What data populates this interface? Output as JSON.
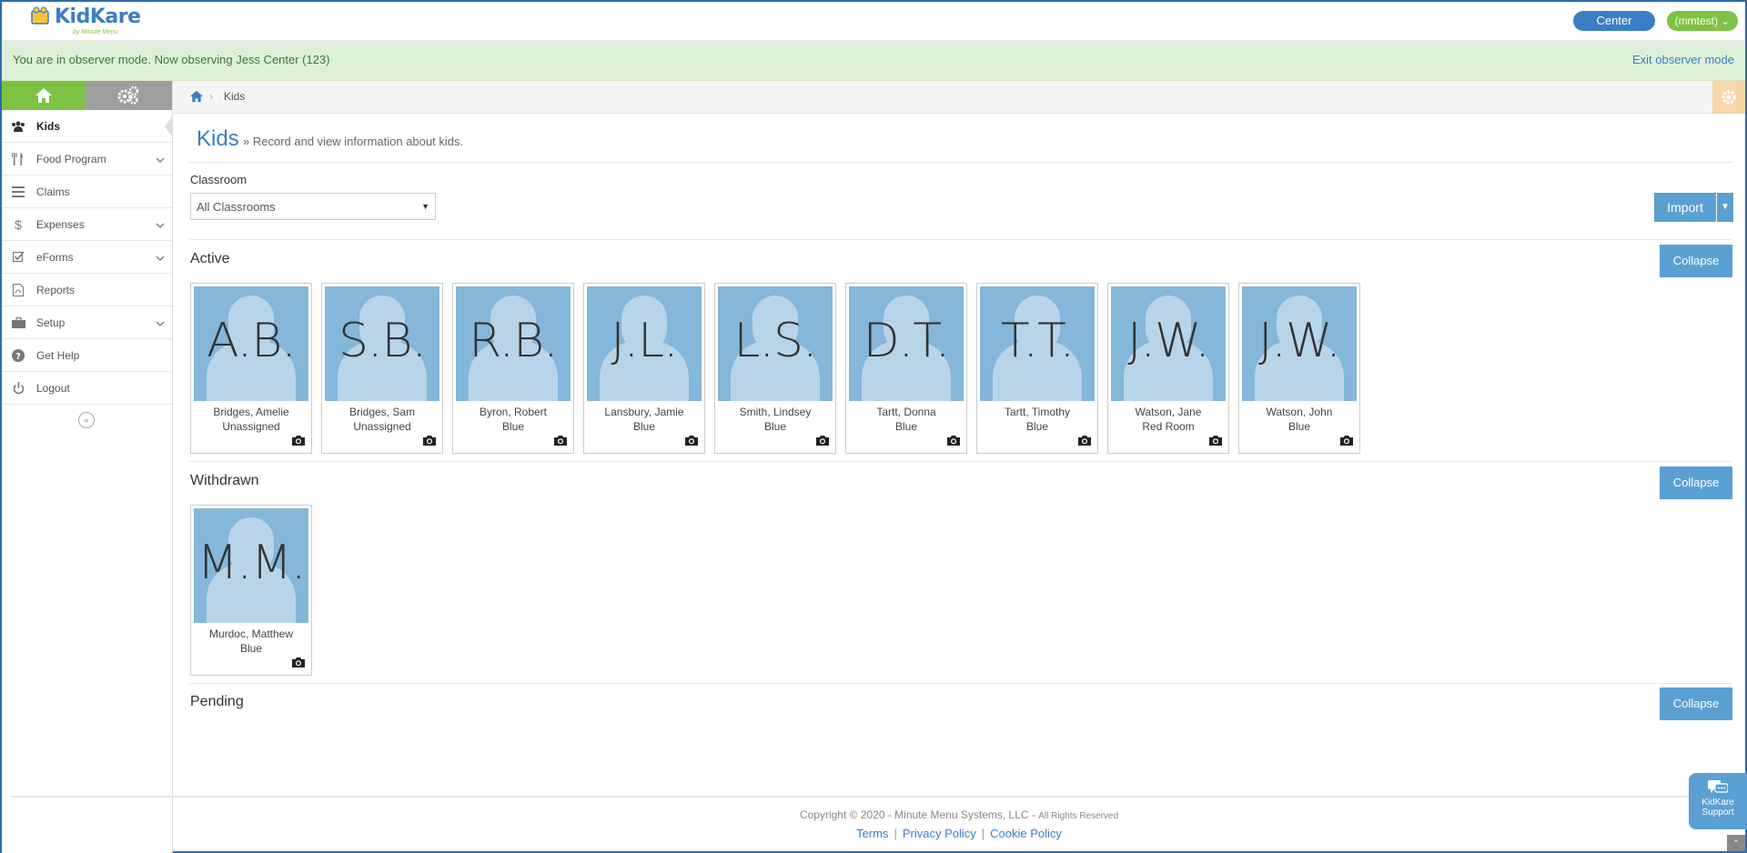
{
  "header": {
    "logo_text": "KidKare",
    "logo_sub": "by Minute Menu",
    "center_label": "Center",
    "user_label": "(mmtest)"
  },
  "observer": {
    "message": "You are in observer mode. Now observing Jess Center (123)",
    "exit_label": "Exit observer mode"
  },
  "sidebar": {
    "items": [
      {
        "label": "Kids",
        "icon": "users-icon"
      },
      {
        "label": "Food Program",
        "icon": "utensils-icon"
      },
      {
        "label": "Claims",
        "icon": "list-icon"
      },
      {
        "label": "Expenses",
        "icon": "dollar-icon"
      },
      {
        "label": "eForms",
        "icon": "checkbox-icon"
      },
      {
        "label": "Reports",
        "icon": "pdf-file-icon"
      },
      {
        "label": "Setup",
        "icon": "briefcase-icon"
      },
      {
        "label": "Get Help",
        "icon": "question-icon"
      },
      {
        "label": "Logout",
        "icon": "power-icon"
      }
    ]
  },
  "breadcrumb": {
    "current": "Kids"
  },
  "page": {
    "title": "Kids",
    "subtitle": "» Record and view information about kids."
  },
  "filter": {
    "label": "Classroom",
    "selected": "All Classrooms"
  },
  "actions": {
    "import_label": "Import"
  },
  "sections": {
    "active": {
      "title": "Active",
      "collapse_label": "Collapse"
    },
    "withdrawn": {
      "title": "Withdrawn",
      "collapse_label": "Collapse"
    },
    "pending": {
      "title": "Pending",
      "collapse_label": "Collapse"
    }
  },
  "kids_active": [
    {
      "initials": "A.B.",
      "name": "Bridges, Amelie",
      "room": "Unassigned"
    },
    {
      "initials": "S.B.",
      "name": "Bridges, Sam",
      "room": "Unassigned"
    },
    {
      "initials": "R.B.",
      "name": "Byron, Robert",
      "room": "Blue"
    },
    {
      "initials": "J.L.",
      "name": "Lansbury, Jamie",
      "room": "Blue"
    },
    {
      "initials": "L.S.",
      "name": "Smith, Lindsey",
      "room": "Blue"
    },
    {
      "initials": "D.T.",
      "name": "Tartt, Donna",
      "room": "Blue"
    },
    {
      "initials": "T.T.",
      "name": "Tartt, Timothy",
      "room": "Blue"
    },
    {
      "initials": "J.W.",
      "name": "Watson, Jane",
      "room": "Red Room"
    },
    {
      "initials": "J.W.",
      "name": "Watson, John",
      "room": "Blue"
    }
  ],
  "kids_withdrawn": [
    {
      "initials": "M.M.",
      "name": "Murdoc, Matthew",
      "room": "Blue"
    }
  ],
  "footer": {
    "copyright": "Copyright © 2020 - Minute Menu Systems, LLC -",
    "rights": "All Rights Reserved",
    "links": [
      "Terms",
      "Privacy Policy",
      "Cookie Policy"
    ]
  },
  "support": {
    "label_line1": "KidKare",
    "label_line2": "Support"
  },
  "colors": {
    "brand_blue": "#3a7ec6",
    "brand_green": "#7dc242",
    "button_blue": "#5ba0d3",
    "avatar_bg": "#84b7d9"
  }
}
